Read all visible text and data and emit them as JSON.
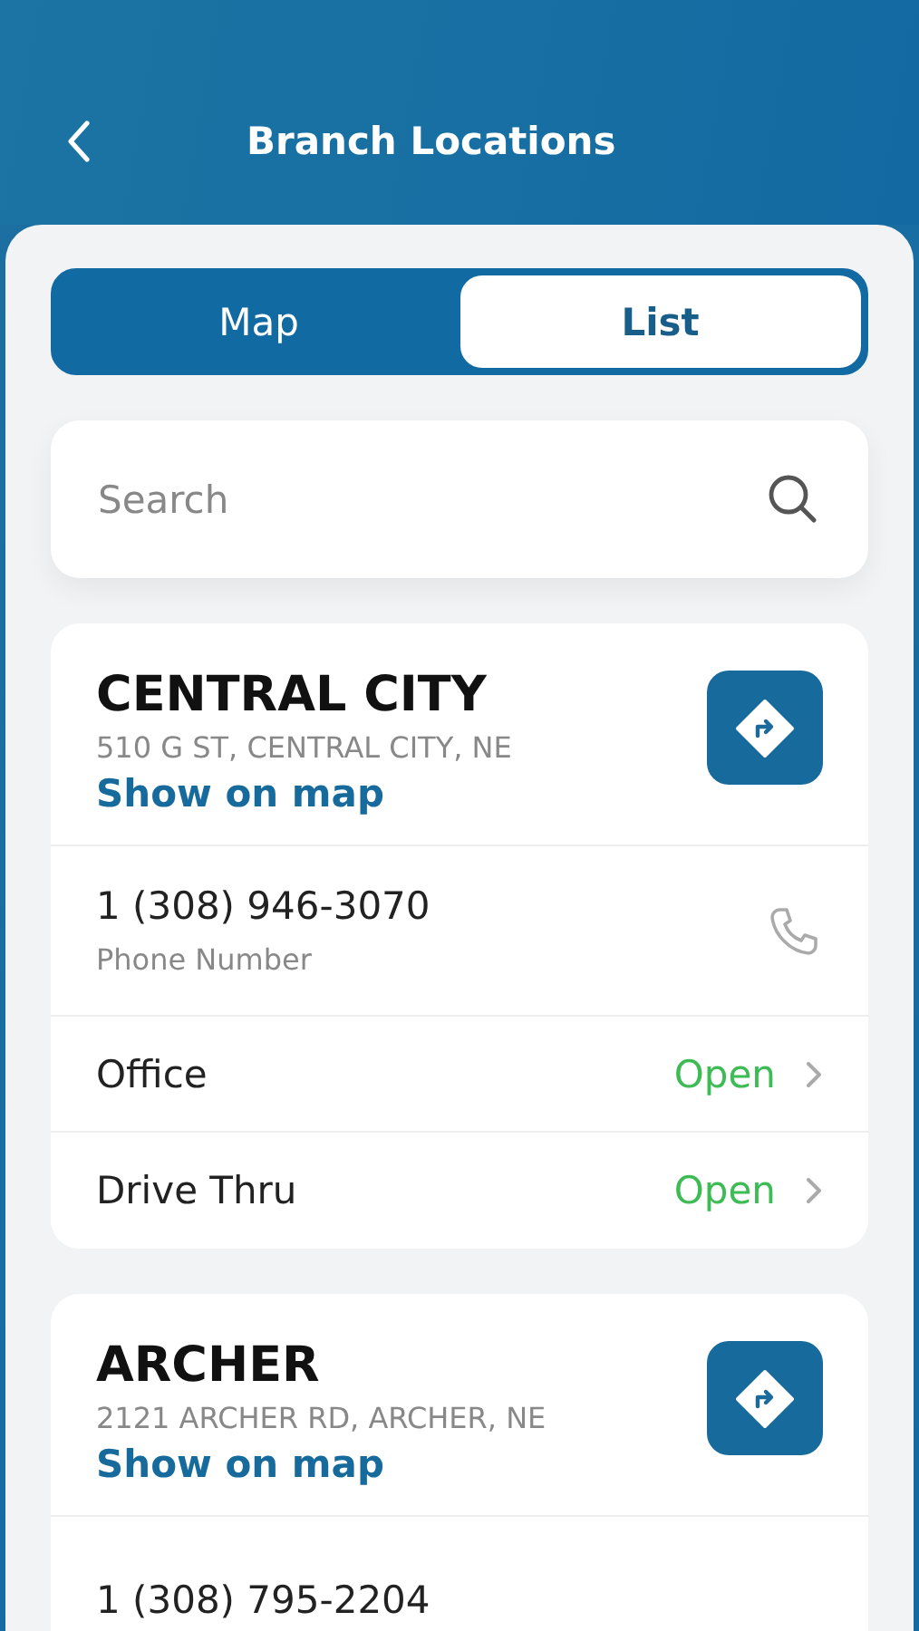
{
  "header": {
    "title": "Branch Locations"
  },
  "tabs": [
    {
      "label": "Map",
      "selected": false
    },
    {
      "label": "List",
      "selected": true
    }
  ],
  "search": {
    "placeholder": "Search"
  },
  "branches": [
    {
      "name": "CENTRAL CITY",
      "address": "510 G ST, CENTRAL CITY, NE",
      "link": "Show on map",
      "phone": "1 (308) 946-3070",
      "phone_label": "Phone Number",
      "hours": [
        {
          "label": "Office",
          "status": "Open",
          "open": true
        },
        {
          "label": "Drive Thru",
          "status": "Open",
          "open": true
        }
      ]
    },
    {
      "name": "ARCHER",
      "address": "2121 ARCHER RD, ARCHER, NE",
      "link": "Show on map",
      "phone": "1 (308) 795-2204"
    }
  ]
}
